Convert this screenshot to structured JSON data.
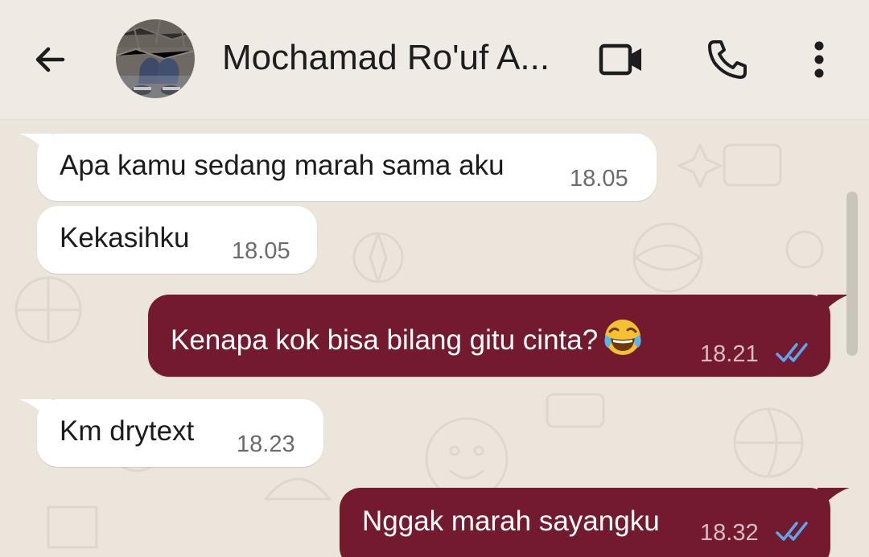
{
  "header": {
    "contact_name": "Mochamad Ro'uf A...",
    "back_icon": "arrow-left-icon",
    "video_icon": "video-camera-icon",
    "call_icon": "phone-icon",
    "menu_icon": "more-vertical-icon"
  },
  "messages": [
    {
      "direction": "incoming",
      "text": "Apa kamu sedang marah sama aku",
      "time": "18.05"
    },
    {
      "direction": "incoming",
      "text": "Kekasihku",
      "time": "18.05"
    },
    {
      "direction": "outgoing",
      "text": "Kenapa kok bisa bilang gitu cinta?",
      "emoji": "face-with-tears-of-joy",
      "time": "18.21",
      "status": "read"
    },
    {
      "direction": "incoming",
      "text": "Km drytext",
      "time": "18.23"
    },
    {
      "direction": "outgoing",
      "text": "Nggak marah sayangku",
      "time": "18.32",
      "status": "read"
    }
  ],
  "colors": {
    "outgoing_bubble": "#741a2e",
    "incoming_bubble": "#ffffff",
    "read_ticks": "#5aa7f0",
    "background": "#ebe5dc"
  }
}
